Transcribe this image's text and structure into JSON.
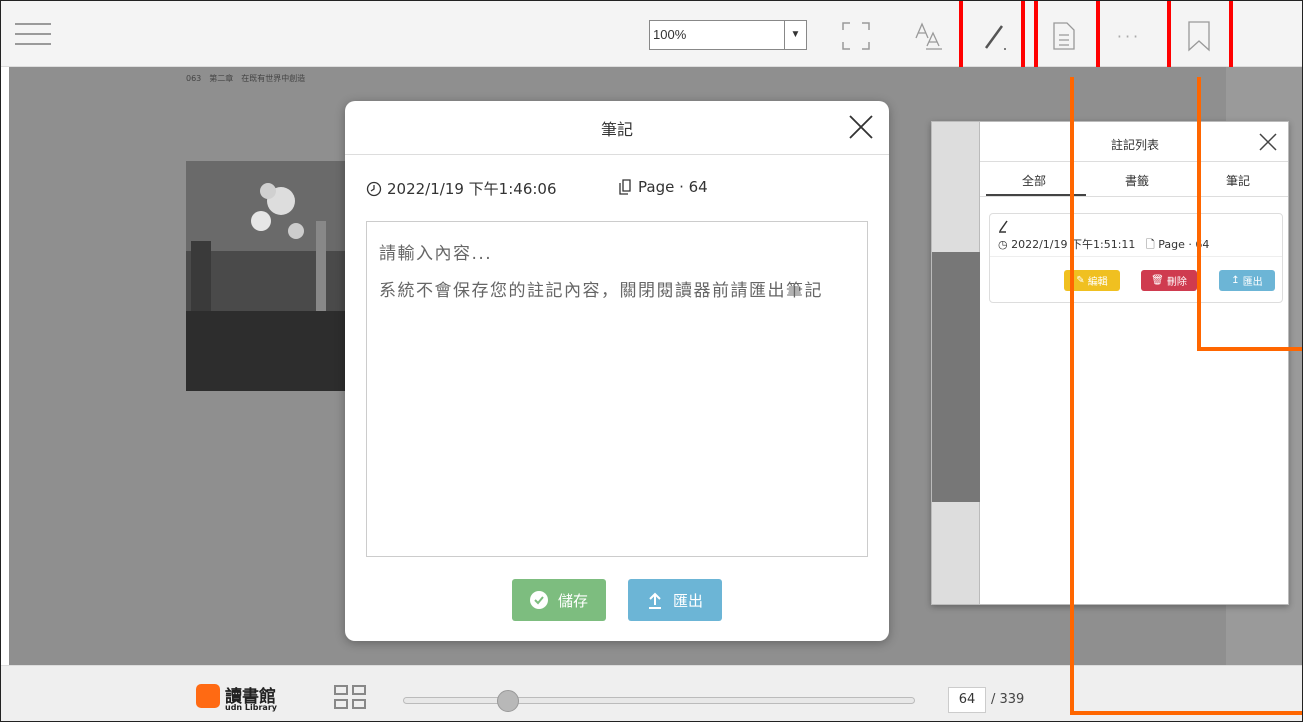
{
  "toolbar": {
    "zoom_value": "100%"
  },
  "book_page": {
    "header_text": "063　第二章　在既有世界中創造"
  },
  "note_modal": {
    "title": "筆記",
    "timestamp": "2022/1/19 下午1:46:06",
    "page_label": "Page · 64",
    "placeholder_line1": "請輸入內容...",
    "placeholder_line2": "系統不會保存您的註記內容，關閉閱讀器前請匯出筆記",
    "save_label": "儲存",
    "export_label": "匯出"
  },
  "note_list": {
    "title": "註記列表",
    "tabs": [
      "全部",
      "書籤",
      "筆記"
    ],
    "card": {
      "timestamp": "2022/1/19 下午1:51:11",
      "page_label": "Page · 64",
      "edit_label": "編輯",
      "delete_label": "刪除",
      "export_label": "匯出"
    }
  },
  "bottom_bar": {
    "logo_main": "讀書館",
    "logo_sub": "udn Library",
    "current_page": "64",
    "total_pages": "/ 339",
    "progress_fraction": 0.189
  },
  "colors": {
    "highlight_box": "#ff0000",
    "connector_line": "#ff6600",
    "save_button": "#7dbd7f",
    "export_button": "#6cb5d6",
    "edit_button": "#f0c020",
    "delete_button": "#cf3b4f",
    "logo": "#ff6a13"
  }
}
